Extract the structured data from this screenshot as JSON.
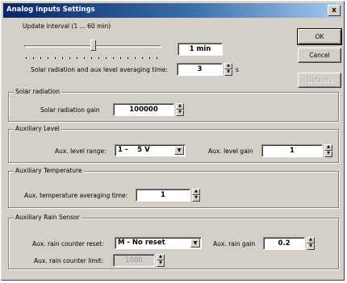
{
  "window": {
    "title": "Analog Inputs Settings",
    "close_glyph": "x"
  },
  "buttons": {
    "ok": "OK",
    "cancel": "Cancel",
    "defaults": "Defaults"
  },
  "update": {
    "label": "Update interval (1 ... 60 min)",
    "slider_fraction": 0.5,
    "value": "1 min",
    "avg_label": "Solar radiation and aux level averaging time:",
    "avg_value": "3",
    "avg_unit": "s"
  },
  "solar": {
    "title": "Solar radiation",
    "gain_label": "Solar radiation gain",
    "gain_value": "100000"
  },
  "aux_level": {
    "title": "Auxiliary Level",
    "range_label": "Aux. level range:",
    "range_value": "1 -    5 V",
    "gain_label": "Aux. level gain",
    "gain_value": "1"
  },
  "aux_temp": {
    "title": "Auxiliary Temperature",
    "avg_label": "Aux. temperature averaging time:",
    "avg_value": "1"
  },
  "aux_rain": {
    "title": "Auxiliary Rain Sensor",
    "reset_label": "Aux. rain counter reset:",
    "reset_value": "M - No reset",
    "gain_label": "Aux. rain gain",
    "gain_value": "0.2",
    "limit_label": "Aux. rain counter limit:",
    "limit_value": "1000"
  }
}
